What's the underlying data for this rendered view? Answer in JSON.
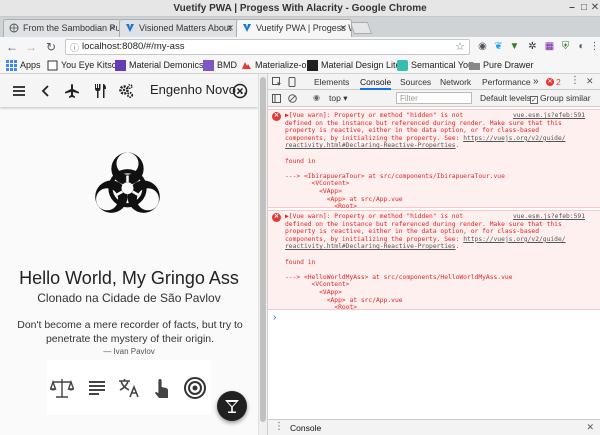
{
  "window": {
    "title": "Vuetify PWA | Progess With Alacrity - Google Chrome"
  },
  "tabs": [
    {
      "label": "From the Sambodian Pu"
    },
    {
      "label": "Visioned Matters About"
    },
    {
      "label": "Vuetify PWA | Progess W"
    }
  ],
  "address": {
    "url": "localhost:8080/#/my-ass"
  },
  "bookmarks": [
    {
      "label": "Apps"
    },
    {
      "label": "You Eye Kitsch"
    },
    {
      "label": "Material Demonics"
    },
    {
      "label": "BMD"
    },
    {
      "label": "Materialize-o"
    },
    {
      "label": "Material Design Lite"
    },
    {
      "label": "Semantical You"
    },
    {
      "label": "Pure Drawer"
    }
  ],
  "app": {
    "toolbar_title": "Engenho Novo...",
    "heading": "Hello World, My Gringo Ass",
    "subheading": "Clonado na Cidade de São Pavlov",
    "quote": "Don't become a mere recorder of facts, but try to penetrate the mystery of their origin.",
    "author": "— Ivan Pavlov"
  },
  "devtools": {
    "tabs": [
      "Elements",
      "Console",
      "Sources",
      "Network",
      "Performance"
    ],
    "active_tab": "Console",
    "more": "»",
    "error_count": "2",
    "context": "top",
    "filter_placeholder": "Filter",
    "levels": "Default levels ▾",
    "group_similar": "Group similar",
    "messages": [
      {
        "source": "vue.esm.js?efeb:591",
        "text": "▶[Vue warn]: Property or method \"hidden\" is not\ndefined on the instance but referenced during render. Make sure that this\nproperty is reactive, either in the data option, or for class-based\ncomponents, by initializing the property. See: ",
        "link1": "https://vuejs.org/v2/guide/",
        "link2": "reactivity.html#Declaring-Reactive-Properties",
        "tail": ".\n\nfound in\n\n---> <IbirapueraTour> at src/components/IbirapueraTour.vue\n       <VContent>\n         <VApp>\n           <App> at src/App.vue\n             <Root>"
      },
      {
        "source": "vue.esm.js?efeb:591",
        "text": "▶[Vue warn]: Property or method \"hidden\" is not\ndefined on the instance but referenced during render. Make sure that this\nproperty is reactive, either in the data option, or for class-based\ncomponents, by initializing the property. See: ",
        "link1": "https://vuejs.org/v2/guide/",
        "link2": "reactivity.html#Declaring-Reactive-Properties",
        "tail": ".\n\nfound in\n\n---> <HelloWorldMyAss> at src/components/HelloWorldMyAss.vue\n       <VContent>\n         <VApp>\n           <App> at src/App.vue\n             <Root>"
      }
    ],
    "prompt": "›",
    "drawer_label": "Console"
  }
}
